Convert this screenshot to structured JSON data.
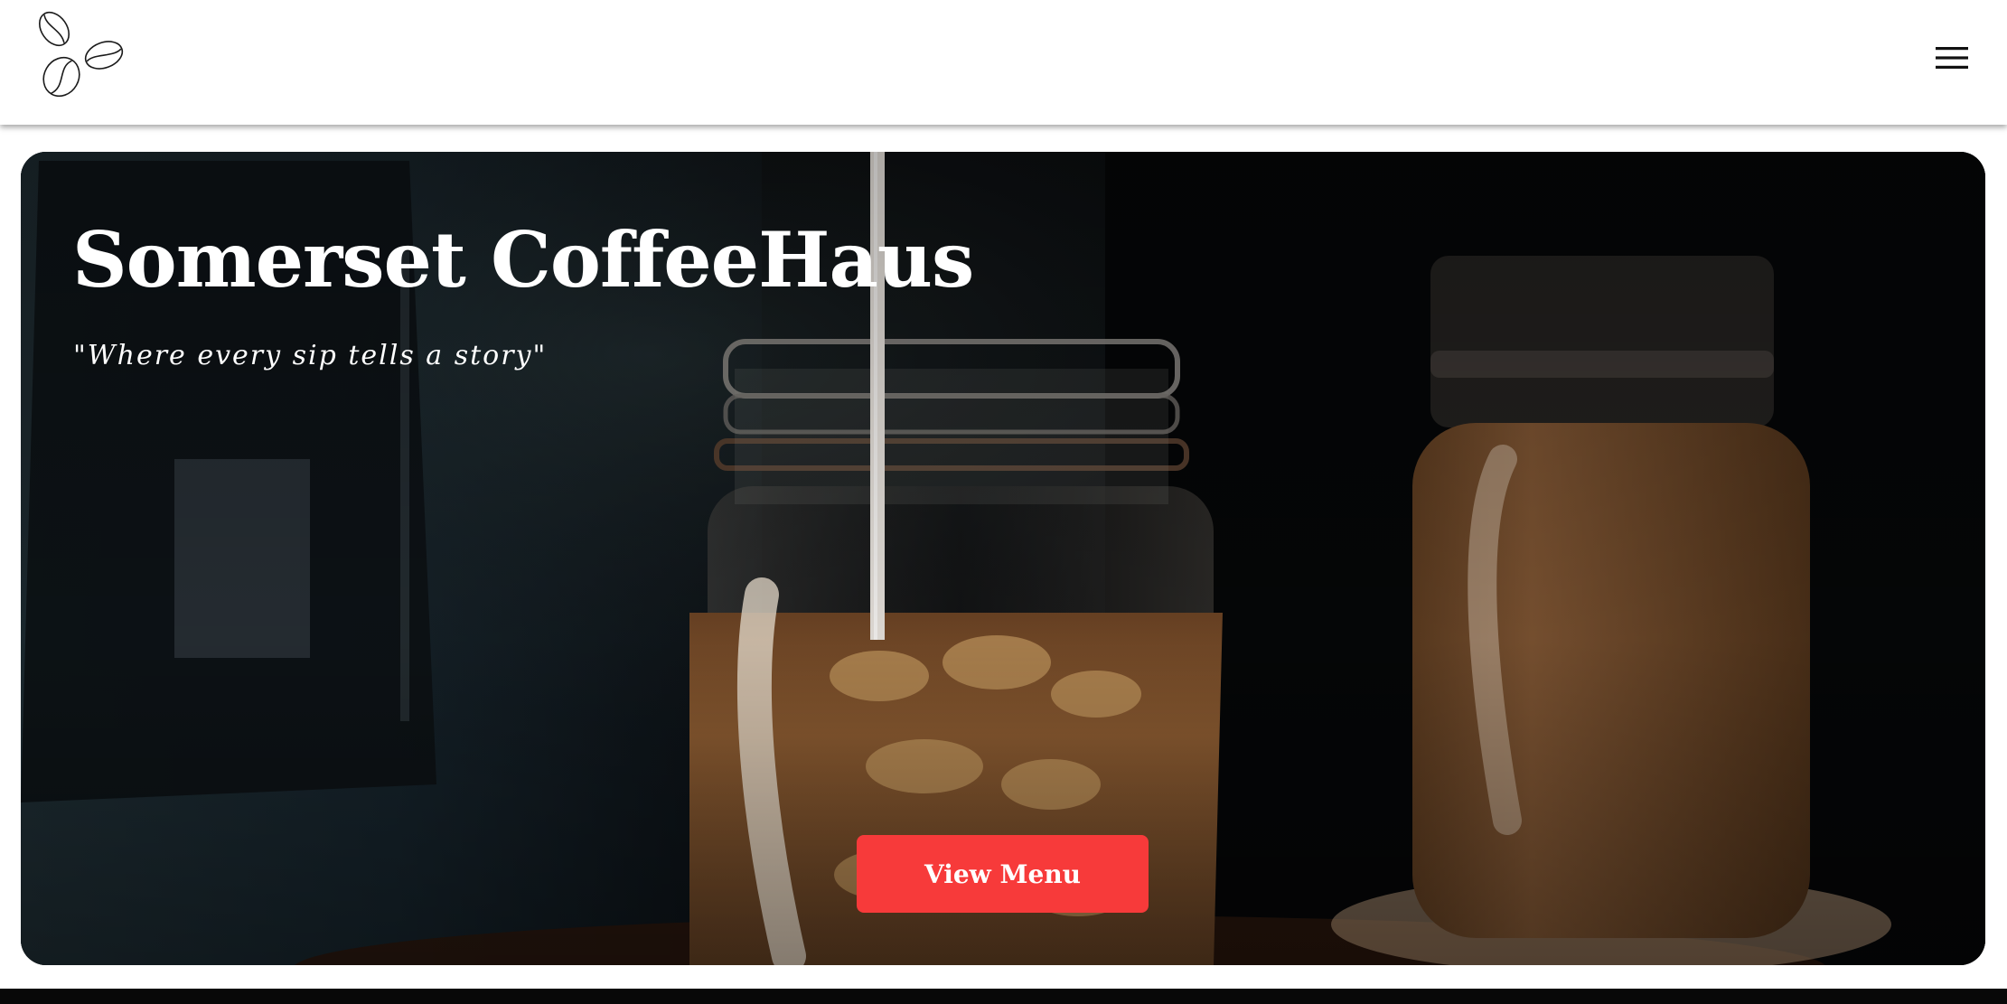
{
  "header": {
    "logo_icon": "coffee-beans-icon",
    "menu_icon": "hamburger-menu-icon"
  },
  "hero": {
    "title": "Somerset CoffeeHaus",
    "tagline": "\"Where every sip tells a story\"",
    "cta_label": "View Menu"
  },
  "colors": {
    "cta_background": "#f73a3a",
    "header_background": "#ffffff",
    "hero_text": "#ffffff",
    "page_bottom_band": "#080808"
  }
}
